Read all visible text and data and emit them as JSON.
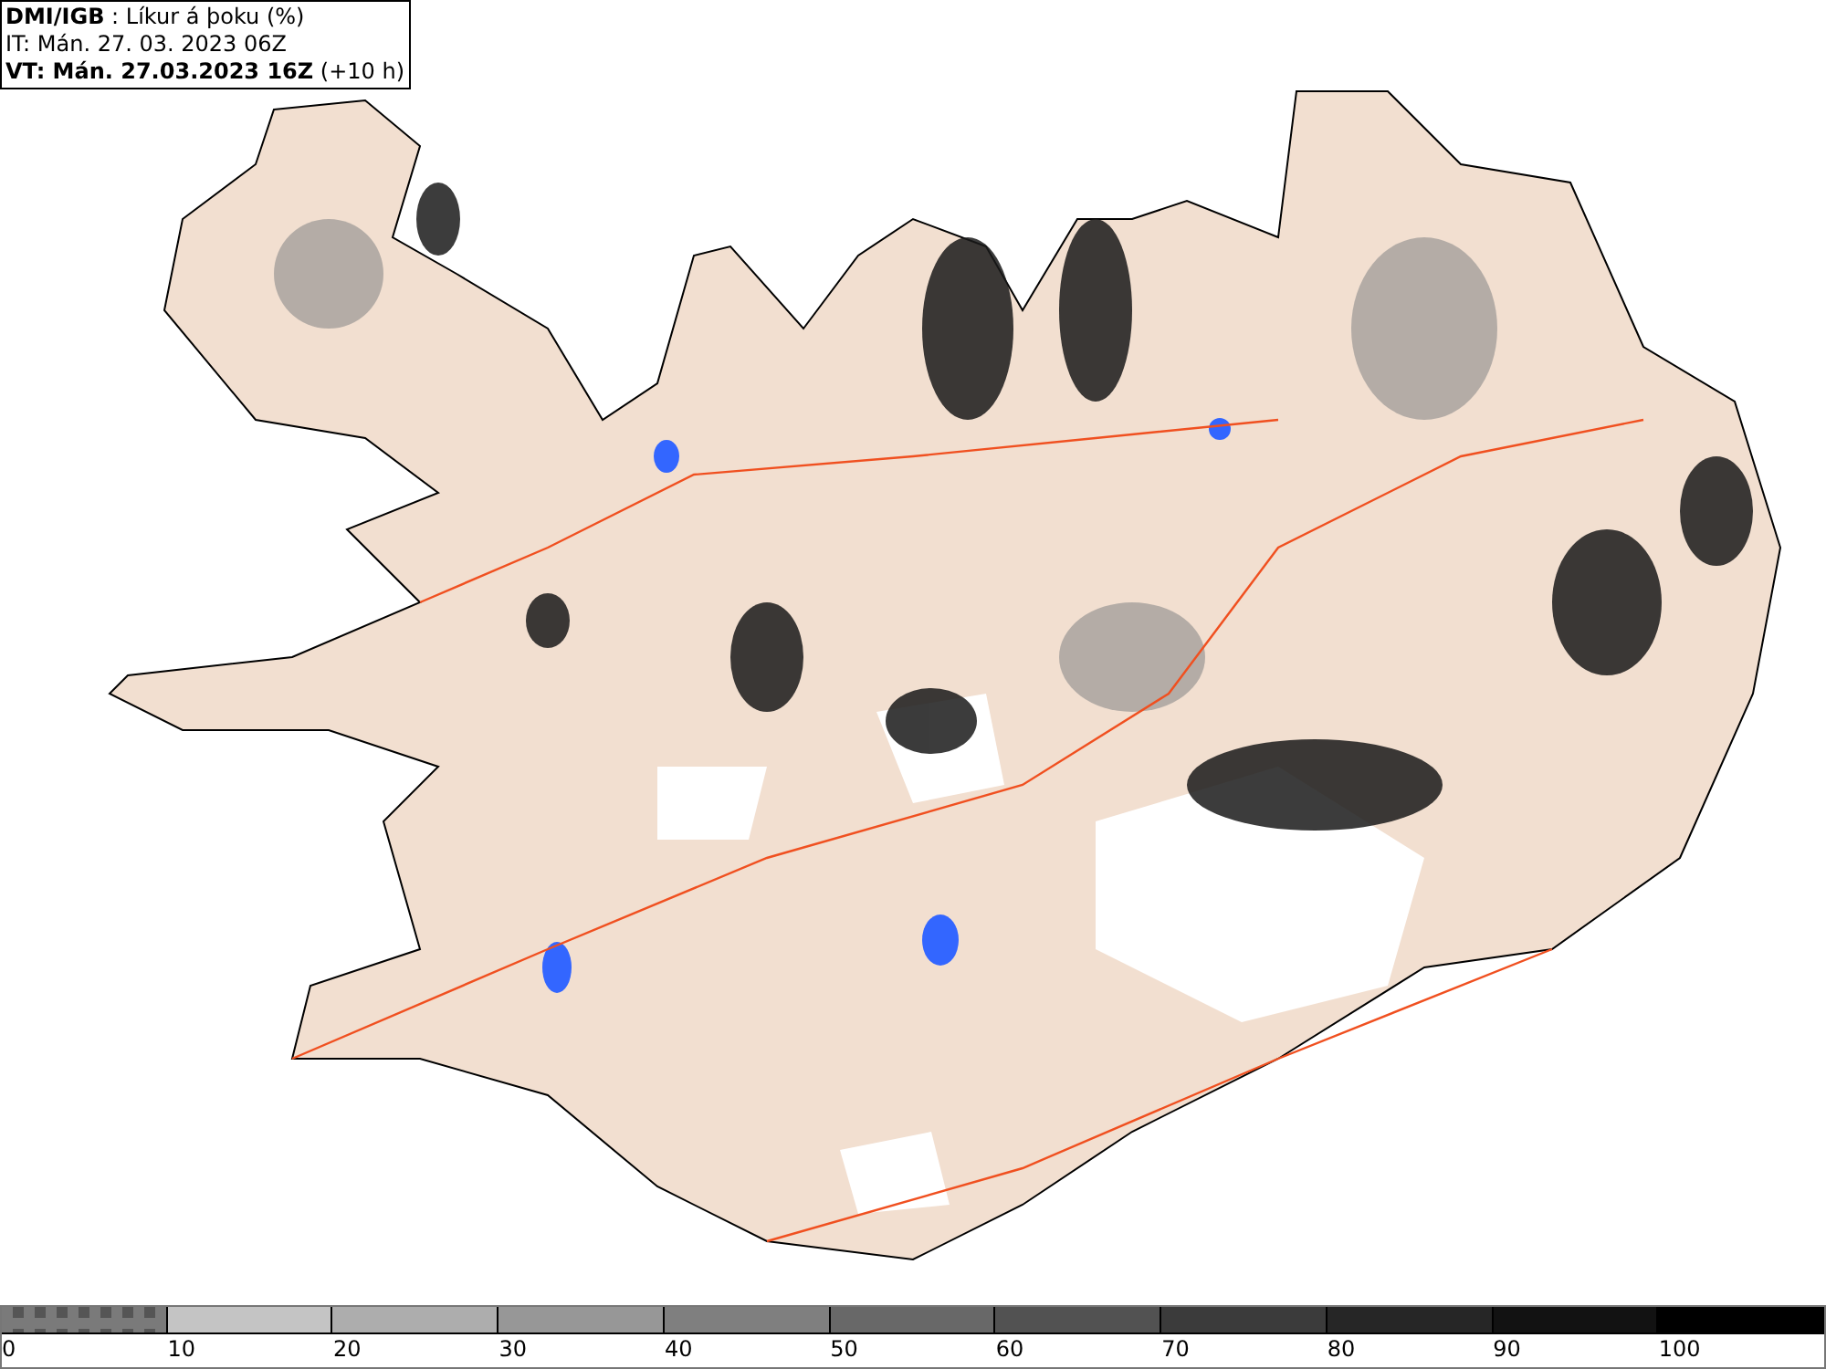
{
  "header": {
    "lines": [
      "**DMI/IGB** : Líkur á þoku (%)",
      "IT: Mán. 27. 03. 2023 06Z",
      "**VT: Mán. 27.03.2023 16Z** (+10 h)"
    ]
  },
  "legend": {
    "segments": [
      {
        "label": "0",
        "color": "#7a7a7a",
        "kind": "checker"
      },
      {
        "label": "10",
        "color": "#c4c4c4",
        "kind": "solid"
      },
      {
        "label": "20",
        "color": "#adadad",
        "kind": "solid"
      },
      {
        "label": "30",
        "color": "#979797",
        "kind": "solid"
      },
      {
        "label": "40",
        "color": "#7f7f7f",
        "kind": "solid"
      },
      {
        "label": "50",
        "color": "#686868",
        "kind": "solid"
      },
      {
        "label": "60",
        "color": "#525252",
        "kind": "solid"
      },
      {
        "label": "70",
        "color": "#3b3b3b",
        "kind": "solid"
      },
      {
        "label": "80",
        "color": "#262626",
        "kind": "solid"
      },
      {
        "label": "90",
        "color": "#121212",
        "kind": "solid"
      },
      {
        "label": "100",
        "color": "#000000",
        "kind": "solid"
      }
    ]
  }
}
